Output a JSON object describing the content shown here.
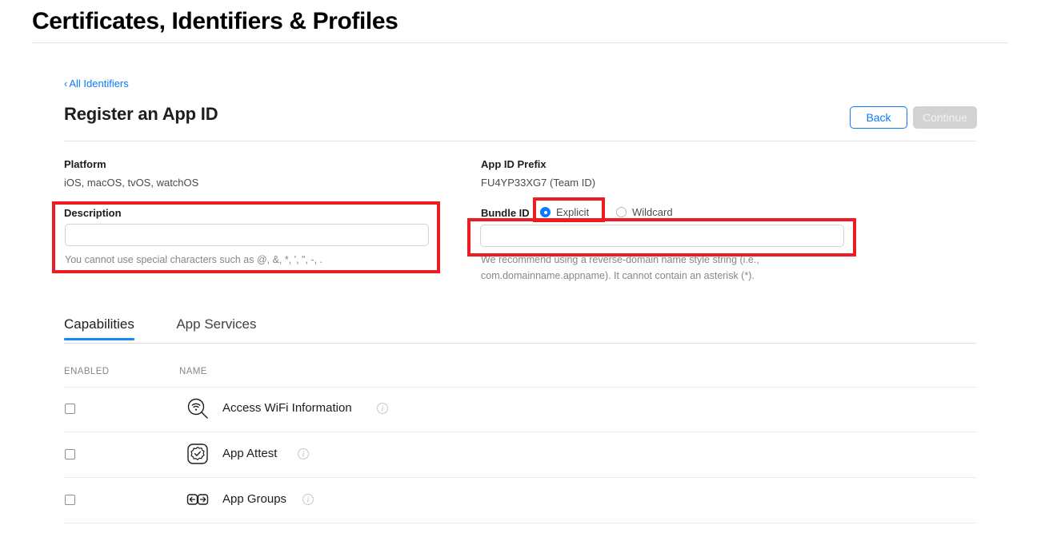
{
  "header": {
    "title": "Certificates, Identifiers & Profiles"
  },
  "breadcrumb": {
    "chevron": "‹",
    "label": "All Identifiers"
  },
  "section": {
    "title": "Register an App ID",
    "back_label": "Back",
    "continue_label": "Continue"
  },
  "form": {
    "platform_label": "Platform",
    "platform_value": "iOS, macOS, tvOS, watchOS",
    "description_label": "Description",
    "description_value": "",
    "description_placeholder": "",
    "description_hint": "You cannot use special characters such as @, &, *, ', \", -, .",
    "prefix_label": "App ID Prefix",
    "prefix_value": "FU4YP33XG7 (Team ID)",
    "bundle_label": "Bundle ID",
    "bundle_explicit_label": "Explicit",
    "bundle_wildcard_label": "Wildcard",
    "bundle_selected": "Explicit",
    "bundle_value": "",
    "bundle_placeholder": "",
    "bundle_hint": "We recommend using a reverse-domain name style string (i.e., com.domainname.appname). It cannot contain an asterisk (*)."
  },
  "tabs": [
    {
      "label": "Capabilities",
      "active": true
    },
    {
      "label": "App Services",
      "active": false
    }
  ],
  "table": {
    "col_enabled": "ENABLED",
    "col_name": "NAME",
    "rows": [
      {
        "name": "Access WiFi Information",
        "icon": "wifi-magnifier-icon",
        "checked": false,
        "info": "i"
      },
      {
        "name": "App Attest",
        "icon": "attest-badge-icon",
        "checked": false,
        "info": "i"
      },
      {
        "name": "App Groups",
        "icon": "app-groups-icon",
        "checked": false,
        "info": "i"
      }
    ]
  },
  "annotations": {
    "accent_color": "#ee1c22",
    "boxes": [
      {
        "name": "description-field-highlight"
      },
      {
        "name": "explicit-radio-highlight"
      },
      {
        "name": "bundle-id-field-highlight"
      }
    ]
  },
  "colors": {
    "link": "#0a7bff",
    "tab_underline": "#1589f5",
    "annotation": "#ee1c22"
  }
}
